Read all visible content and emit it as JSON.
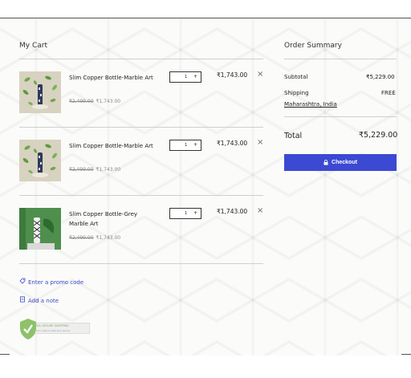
{
  "cart": {
    "title": "My Cart",
    "items": [
      {
        "name": "Slim Copper Bottle-Marble Art",
        "original_price": "₹2,499.00",
        "price": "₹1,743.00",
        "quantity": "1",
        "line_total": "₹1,743.00",
        "remove": "×",
        "image": "marble-bottle-leaves-photo"
      },
      {
        "name": "Slim Copper Bottle-Marble Art",
        "original_price": "₹2,499.00",
        "price": "₹1,743.00",
        "quantity": "1",
        "line_total": "₹1,743.00",
        "remove": "×",
        "image": "marble-bottle-leaves-photo"
      },
      {
        "name": "Slim Copper Bottle-Grey Marble Art",
        "original_price": "₹2,499.00",
        "price": "₹1,743.00",
        "quantity": "1",
        "line_total": "₹1,743.00",
        "remove": "×",
        "image": "grey-marble-bottle-green-photo"
      }
    ],
    "promo_link": "Enter a promo code",
    "note_link": "Add a note",
    "badge": {
      "line1": "SSL SECURE SHOPPING",
      "line2": "Your data is safe and secure"
    }
  },
  "summary": {
    "title": "Order Summary",
    "subtotal_label": "Subtotal",
    "subtotal_value": "₹5,229.00",
    "shipping_label": "Shipping",
    "shipping_value": "FREE",
    "shipping_location": "Maharashtra, India",
    "total_label": "Total",
    "total_value": "₹5,229.00",
    "checkout_label": "Checkout"
  },
  "colors": {
    "accent": "#3b49d3",
    "link": "#3949c9"
  }
}
